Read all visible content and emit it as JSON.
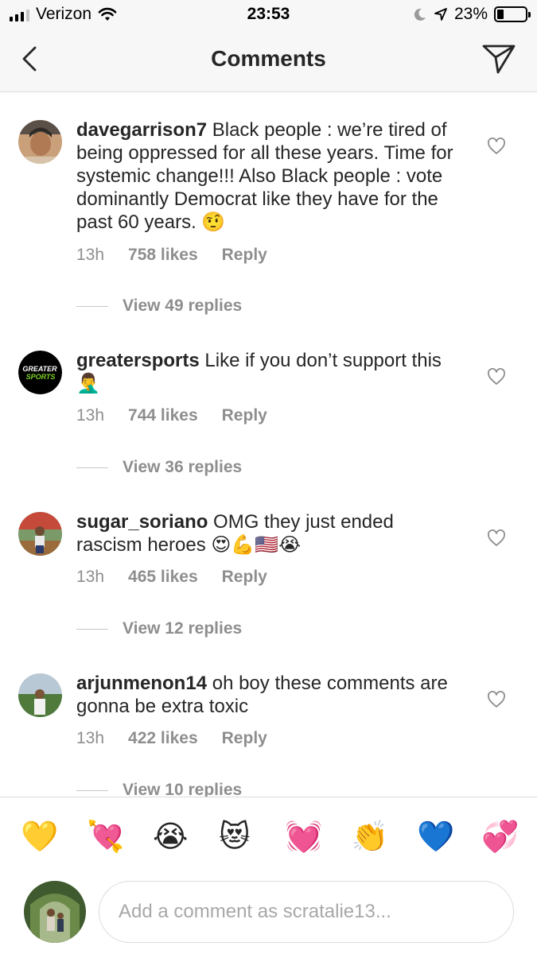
{
  "status_bar": {
    "carrier": "Verizon",
    "time": "23:53",
    "battery": "23%",
    "battery_level": 0.23,
    "icons": [
      "signal-icon",
      "wifi-icon",
      "moon-icon",
      "location-icon",
      "battery-icon"
    ]
  },
  "header": {
    "title": "Comments",
    "back_icon": "chevron-left-icon",
    "send_icon": "paper-plane-icon"
  },
  "comments": [
    {
      "username": "davegarrison7",
      "text": " Black people : we’re tired of being oppressed for all these years. Time for systemic change!!! Also Black people : vote dominantly Democrat like they have for the past 60 years. 🤨",
      "time": "13h",
      "likes": "758 likes",
      "reply": "Reply",
      "view_replies": "View 49 replies"
    },
    {
      "username": "greatersports",
      "avatar_text": [
        "GREATER",
        "SPORTS"
      ],
      "text": " Like if you don’t support this 🤦‍♂️",
      "time": "13h",
      "likes": "744 likes",
      "reply": "Reply",
      "view_replies": "View 36 replies"
    },
    {
      "username": "sugar_soriano",
      "text": " OMG they just ended rascism heroes 😍💪🇺🇸😭",
      "time": "13h",
      "likes": "465 likes",
      "reply": "Reply",
      "view_replies": "View 12 replies"
    },
    {
      "username": "arjunmenon14",
      "text": " oh boy these comments are gonna be extra toxic",
      "time": "13h",
      "likes": "422 likes",
      "reply": "Reply",
      "view_replies": "View 10 replies"
    }
  ],
  "emoji_bar": [
    "💛",
    "💘",
    "😭",
    "😻",
    "💓",
    "👏",
    "💙",
    "💞"
  ],
  "input": {
    "placeholder": "Add a comment as scratalie13...",
    "value": ""
  },
  "colors": {
    "text": "#262626",
    "secondary": "#8e8e8e",
    "divider": "#dbdbdb",
    "header_bg": "#f7f7f7",
    "greater_sports_green": "#7ed321"
  }
}
